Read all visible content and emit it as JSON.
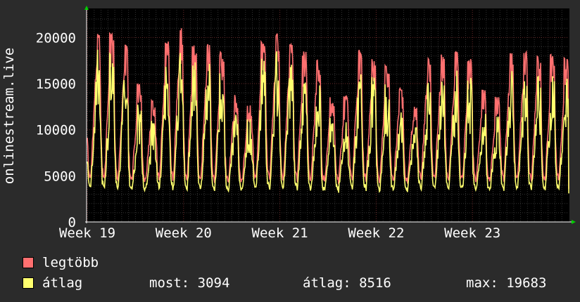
{
  "chart_data": {
    "type": "line",
    "title": "",
    "xlabel": "",
    "ylabel": "onlinestream.live",
    "x_ticks": [
      "Week 19",
      "Week 20",
      "Week 21",
      "Week 22",
      "Week 23"
    ],
    "x_days": 35,
    "y_ticks": [
      0,
      5000,
      10000,
      15000,
      20000
    ],
    "ylim": [
      0,
      23000
    ],
    "grid": true,
    "legend_position": "bottom-left",
    "daily_peaks": {
      "legtobb": [
        20400,
        20500,
        19300,
        15000,
        13200,
        19600,
        21000,
        19400,
        19300,
        18500,
        14000,
        12900,
        19600,
        20500,
        19700,
        18500,
        18000,
        13700,
        13700,
        18700,
        17800,
        17100,
        14700,
        13000,
        18000,
        18400,
        18500,
        17800,
        14500,
        13600,
        18400,
        18500,
        18300,
        18200,
        17800
      ],
      "atlag": [
        18700,
        18300,
        17700,
        12800,
        11000,
        17800,
        18600,
        17700,
        17300,
        16700,
        12600,
        11500,
        17900,
        18500,
        17800,
        16600,
        16000,
        11500,
        11200,
        16700,
        15900,
        15100,
        12400,
        11000,
        15800,
        16400,
        16500,
        15800,
        12400,
        11500,
        16500,
        16500,
        16200,
        16100,
        15700
      ]
    },
    "series": [
      {
        "name": "legtöbb",
        "color": "#ff7070",
        "values": []
      },
      {
        "name": "átlag",
        "color": "#ffff6e",
        "values": []
      }
    ]
  },
  "colors": {
    "plot_background": "#000000",
    "page_background": "#2b2b2b",
    "grid_minor": "#333333",
    "grid_major": "#6a2a2a",
    "axis_arrow": "#00cc00"
  },
  "legend": {
    "max_label": "legtöbb",
    "avg_label": "átlag"
  },
  "stats": {
    "now": "most: 3094",
    "avg": "átlag: 8516",
    "max": "max: 19683"
  }
}
